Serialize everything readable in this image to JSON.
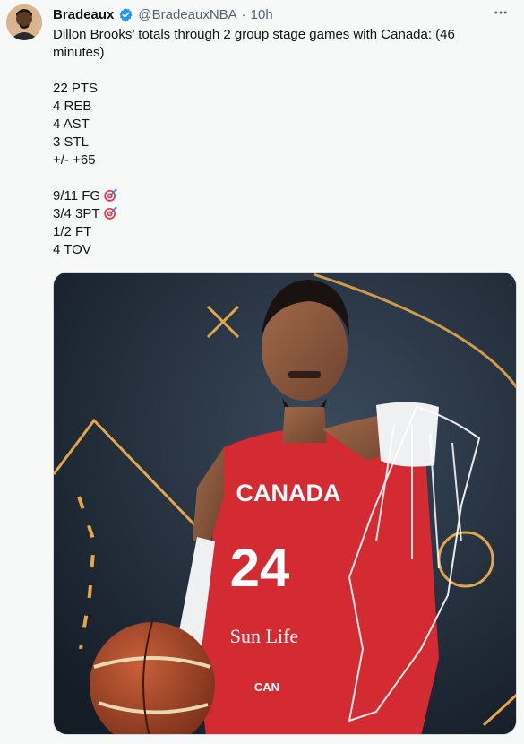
{
  "tweet": {
    "author_name": "Bradeaux",
    "author_handle": "@BradeauxNBA",
    "separator": "·",
    "time": "10h",
    "more_icon": "more-horizontal-icon",
    "verified_icon": "verified-badge-icon",
    "verified_color": "#1d9bf0",
    "lines": [
      "Dillon Brooks’ totals through 2 group stage games with Canada: (46",
      "minutes)"
    ],
    "stats": [
      "22 PTS",
      "4 REB",
      "4 AST",
      "3 STL",
      "+/- +65"
    ],
    "shooting": [
      {
        "text": "9/11 FG",
        "emoji": "direct-hit-icon"
      },
      {
        "text": "3/4 3PT",
        "emoji": "direct-hit-icon"
      },
      {
        "text": "1/2 FT",
        "emoji": ""
      },
      {
        "text": "4 TOV",
        "emoji": ""
      }
    ],
    "photo": {
      "jersey_team": "CANADA",
      "jersey_number": "24",
      "sponsor": "Sun Life",
      "shorts_text": "CAN",
      "jersey_color": "#d42a32",
      "accent_color": "#e3a74a"
    }
  }
}
